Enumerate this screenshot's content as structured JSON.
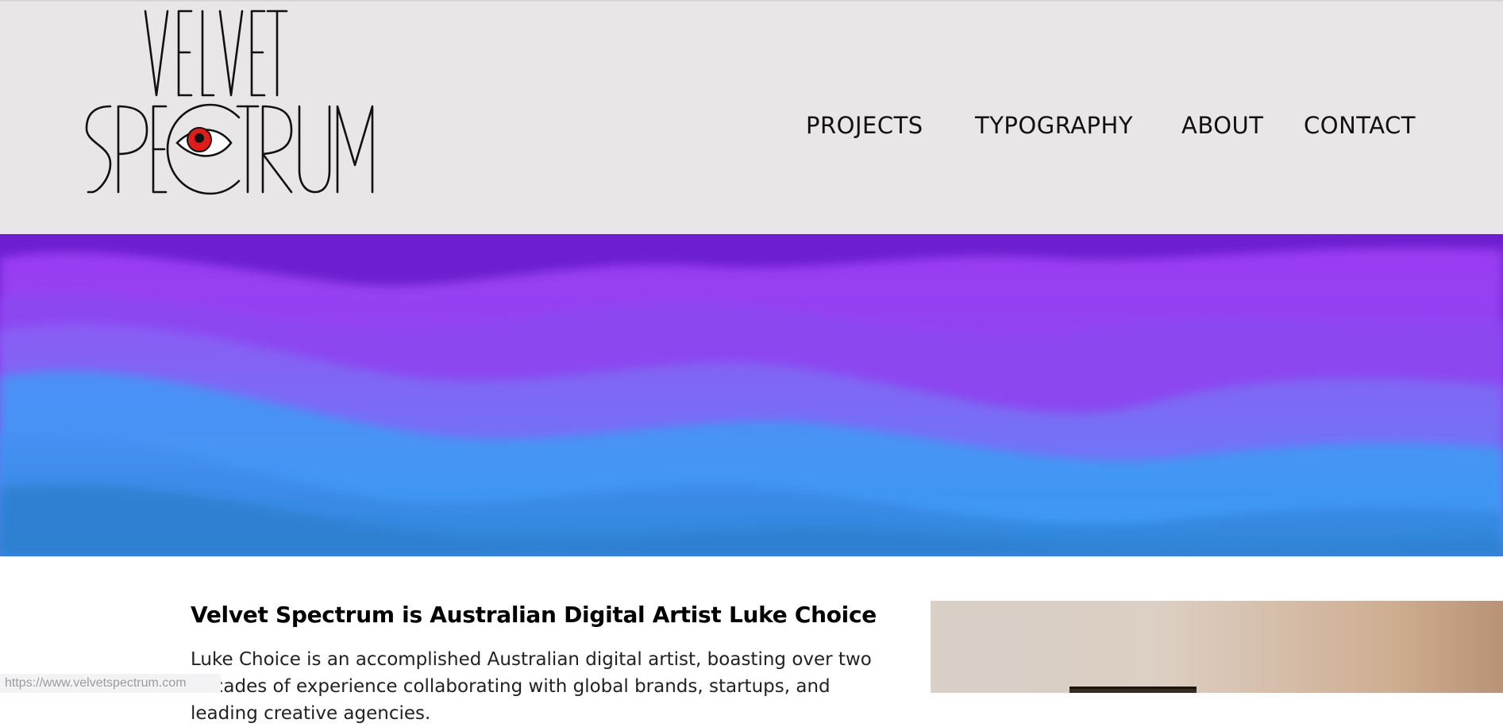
{
  "brand": {
    "logo_alt": "Velvet Spectrum"
  },
  "nav": {
    "items": [
      {
        "label": "PROJECTS"
      },
      {
        "label": "TYPOGRAPHY"
      },
      {
        "label": "ABOUT"
      },
      {
        "label": "CONTACT"
      }
    ]
  },
  "main": {
    "title": "Velvet Spectrum is Australian Digital Artist Luke Choice",
    "body": "Luke Choice is an accomplished Australian digital artist, boasting over two decades of experience collaborating with global brands, startups, and leading creative agencies."
  },
  "status_bar": {
    "url": "https://www.velvetspectrum.com"
  },
  "colors": {
    "header_bg": "#e8e6e7",
    "hero_purple": "#8a2bee",
    "hero_blue": "#3a9cf2",
    "eye_red": "#e01b1b"
  }
}
